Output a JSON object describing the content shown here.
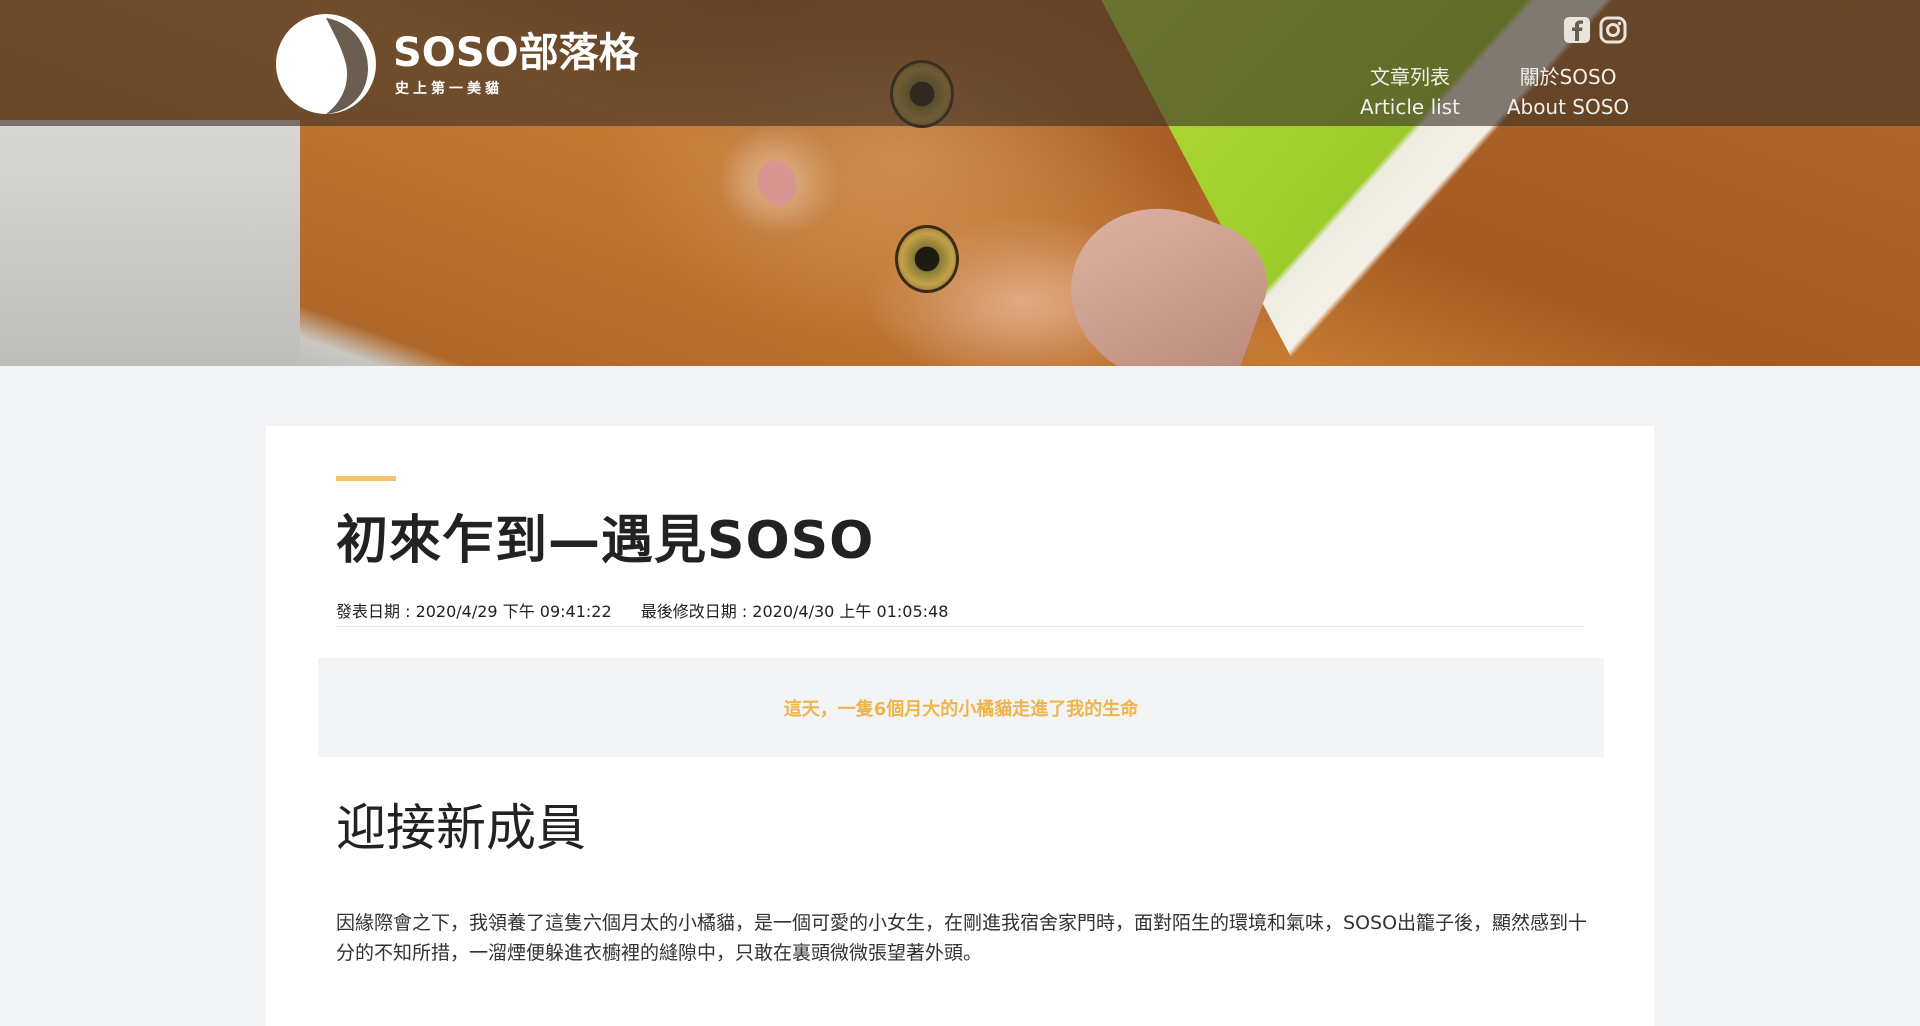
{
  "brand": {
    "title": "SOSO部落格",
    "subtitle": "史上第一美貓"
  },
  "nav": [
    {
      "zh": "文章列表",
      "en": "Article list"
    },
    {
      "zh": "關於SOSO",
      "en": "About SOSO"
    }
  ],
  "social": [
    {
      "name": "facebook-icon"
    },
    {
      "name": "instagram-icon"
    }
  ],
  "article": {
    "title": "初來乍到—遇見SOSO",
    "published": "發表日期 : 2020/4/29 下午 09:41:22",
    "modified": "最後修改日期 : 2020/4/30 上午 01:05:48",
    "quote": "這天，一隻6個月大的小橘貓走進了我的生命",
    "section_title": "迎接新成員",
    "paragraph": "因緣際會之下，我領養了這隻六個月太的小橘貓，是一個可愛的小女生，在剛進我宿舍家門時，面對陌生的環境和氣味，SOSO出籠子後，顯然感到十分的不知所措，一溜煙便躲進衣櫥裡的縫隙中，只敢在裏頭微微張望著外頭。"
  },
  "colors": {
    "accent": "#f2c36b",
    "quote_text": "#f0b44c",
    "page_bg": "#f3f4f6"
  }
}
